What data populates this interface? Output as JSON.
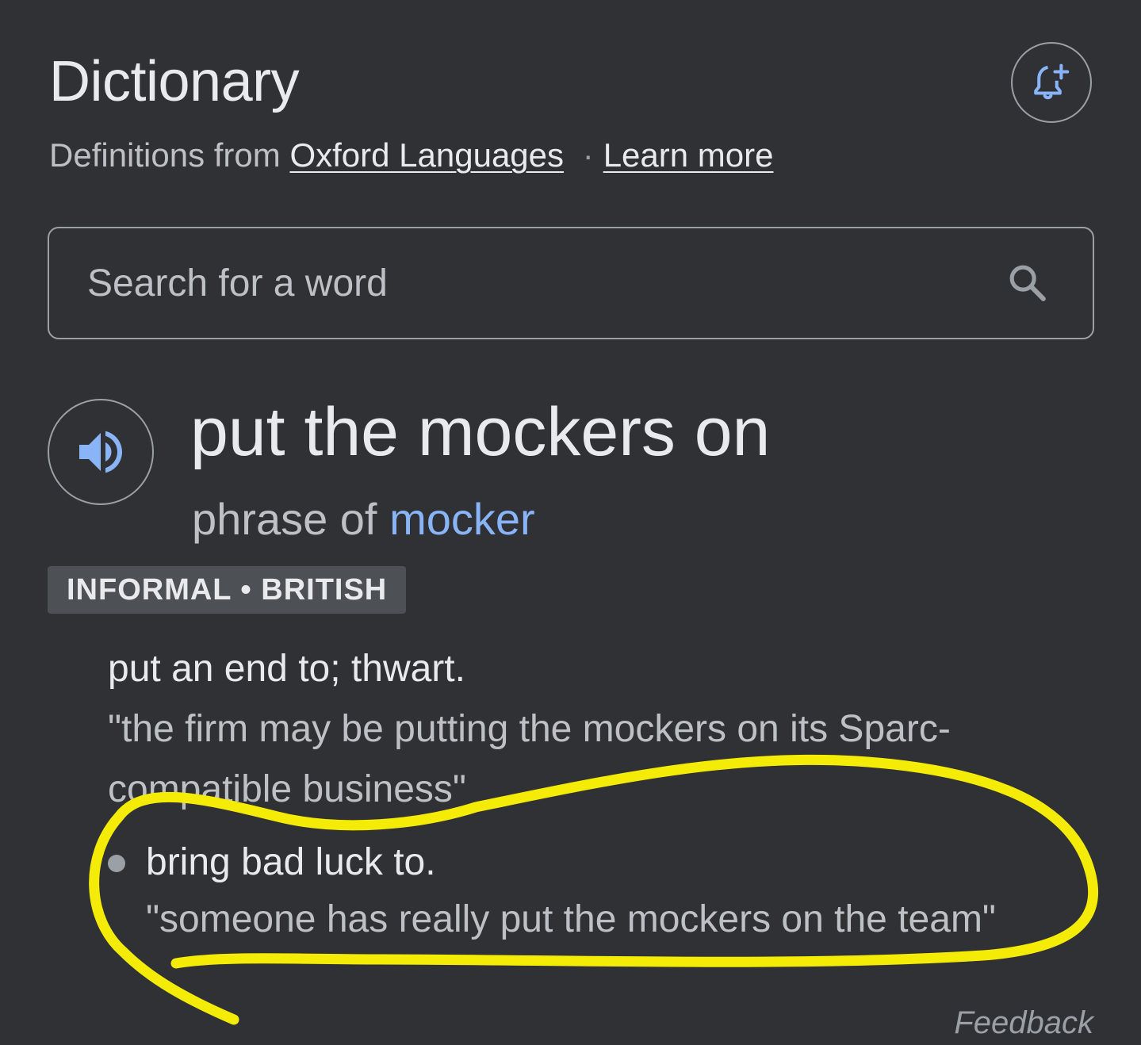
{
  "header": {
    "title": "Dictionary",
    "alert_icon": "bell-plus-icon",
    "source_prefix": "Definitions from",
    "source_link": "Oxford Languages",
    "separator": "·",
    "learn_more": "Learn more"
  },
  "search": {
    "placeholder": "Search for a word",
    "icon": "search-icon"
  },
  "entry": {
    "speaker_icon": "speaker-icon",
    "headword": "put the mockers on",
    "phrase_prefix": "phrase of",
    "phrase_link": "mocker",
    "label": "INFORMAL • BRITISH",
    "senses": [
      {
        "definition": "put an end to; thwart.",
        "example": "\"the firm may be putting the mockers on its Sparc-compatible business\""
      },
      {
        "definition": "bring bad luck to.",
        "example": "\"someone has really put the mockers on the team\""
      }
    ]
  },
  "footer": {
    "feedback": "Feedback"
  },
  "colors": {
    "background": "#303134",
    "text_primary": "#e8eaed",
    "text_secondary": "#bdc1c6",
    "link_blue": "#8ab4f8",
    "annotation_yellow": "#f4ec06"
  }
}
